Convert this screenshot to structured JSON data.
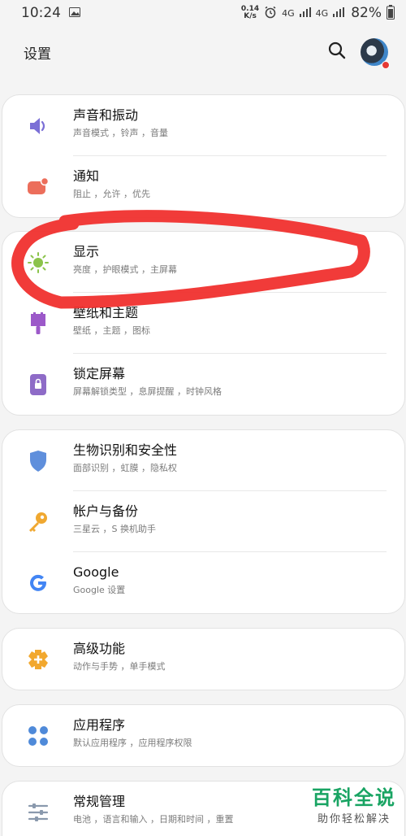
{
  "status_bar": {
    "time": "10:24",
    "net_speed_value": "0.14",
    "net_speed_unit": "K/s",
    "signal_1": "4G",
    "signal_2": "4G",
    "battery": "82%"
  },
  "header": {
    "title": "设置"
  },
  "groups": [
    {
      "items": [
        {
          "title": "声音和振动",
          "subtitle": "声音模式 ，铃声 ，音量",
          "icon": "speaker-icon",
          "color": "#7b6fd6"
        },
        {
          "title": "通知",
          "subtitle": "阻止 ，允许 ，优先",
          "icon": "notification-icon",
          "color": "#ec6e5b"
        }
      ]
    },
    {
      "items": [
        {
          "title": "显示",
          "subtitle": "亮度 ，护眼模式 ，主屏幕",
          "icon": "brightness-icon",
          "color": "#8bc34a"
        },
        {
          "title": "壁纸和主题",
          "subtitle": "壁纸 ，主题 ，图标",
          "icon": "theme-brush-icon",
          "color": "#9c59c9"
        },
        {
          "title": "锁定屏幕",
          "subtitle": "屏幕解锁类型 ，息屏提醒 ，时钟风格",
          "icon": "lock-screen-icon",
          "color": "#8e6bc7"
        }
      ]
    },
    {
      "items": [
        {
          "title": "生物识别和安全性",
          "subtitle": "面部识别 ，虹膜 ，隐私权",
          "icon": "shield-icon",
          "color": "#5f8fdc"
        },
        {
          "title": "帐户与备份",
          "subtitle": "三星云 ，S 换机助手",
          "icon": "key-icon",
          "color": "#f0a830"
        },
        {
          "title": "Google",
          "subtitle": "Google 设置",
          "icon": "google-icon",
          "color": "#4285f4"
        }
      ]
    },
    {
      "items": [
        {
          "title": "高级功能",
          "subtitle": "动作与手势 ，单手模式",
          "icon": "advanced-features-icon",
          "color": "#f2a82e"
        }
      ]
    },
    {
      "items": [
        {
          "title": "应用程序",
          "subtitle": "默认应用程序 ，应用程序权限",
          "icon": "apps-grid-icon",
          "color": "#4f8ad9"
        }
      ]
    },
    {
      "items": [
        {
          "title": "常规管理",
          "subtitle": "电池 ，语言和输入 ，日期和时间 ，重置",
          "icon": "sliders-icon",
          "color": "#8a99ad"
        }
      ]
    }
  ],
  "watermark": {
    "title": "百科全说",
    "subtitle": "助你轻松解决"
  },
  "annotation": {
    "color": "#f0302e"
  }
}
